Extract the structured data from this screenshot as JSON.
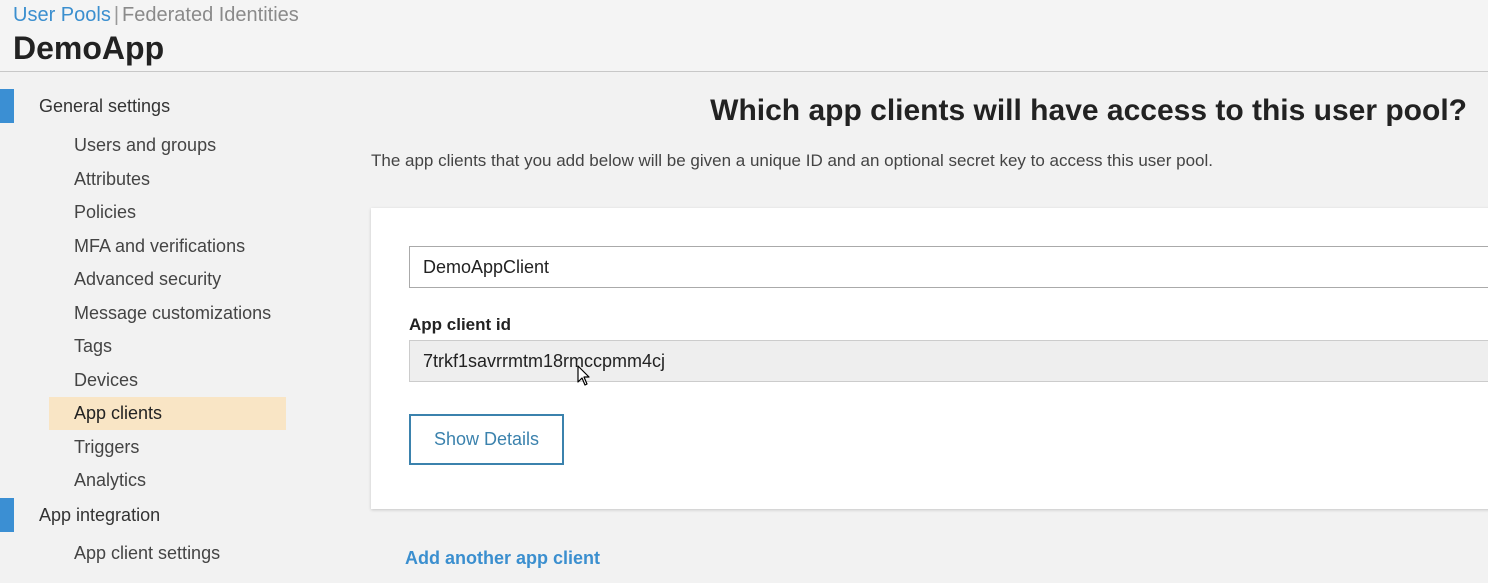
{
  "header": {
    "breadcrumb": {
      "user_pools": "User Pools",
      "separator": "|",
      "federated_identities": "Federated Identities"
    },
    "title": "DemoApp"
  },
  "sidebar": {
    "sections": [
      {
        "label": "General settings"
      },
      {
        "label": "App integration"
      }
    ],
    "general_items": [
      {
        "label": "Users and groups"
      },
      {
        "label": "Attributes"
      },
      {
        "label": "Policies"
      },
      {
        "label": "MFA and verifications"
      },
      {
        "label": "Advanced security"
      },
      {
        "label": "Message customizations"
      },
      {
        "label": "Tags"
      },
      {
        "label": "Devices"
      },
      {
        "label": "App clients",
        "active": true
      },
      {
        "label": "Triggers"
      },
      {
        "label": "Analytics"
      }
    ],
    "integration_items": [
      {
        "label": "App client settings"
      }
    ]
  },
  "main": {
    "heading": "Which app clients will have access to this user pool?",
    "description": "The app clients that you add below will be given a unique ID and an optional secret key to access this user pool.",
    "client": {
      "name_value": "DemoAppClient",
      "id_label": "App client id",
      "id_value": "7trkf1savrrmtm18rmccpmm4cj",
      "show_details_label": "Show Details"
    },
    "add_link": "Add another app client"
  },
  "colors": {
    "accent": "#3b8fd3",
    "link": "#3b8fcf",
    "active_bg": "#f9e5c5",
    "button_border": "#3b82ad"
  },
  "icons": {
    "cursor": "mouse-pointer-icon"
  }
}
